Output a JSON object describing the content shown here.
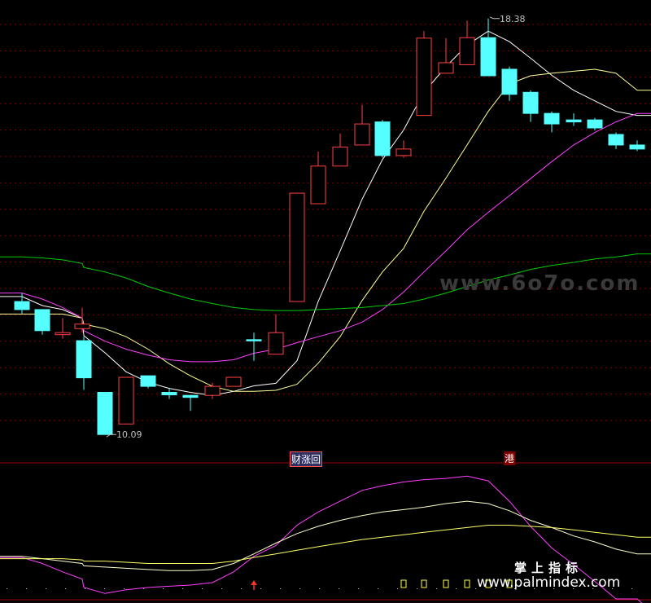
{
  "chart_data": {
    "type": "candlestick",
    "candles": [
      {
        "open": 12.74,
        "close": 12.58,
        "high": 12.91,
        "low": 12.5,
        "dir": "down"
      },
      {
        "open": 12.58,
        "close": 12.16,
        "high": 12.58,
        "low": 12.08,
        "dir": "down"
      },
      {
        "open": 12.08,
        "close": 12.12,
        "high": 12.41,
        "low": 12.0,
        "dir": "up"
      },
      {
        "open": 12.2,
        "close": 12.29,
        "high": 12.62,
        "low": 12.12,
        "dir": "up"
      },
      {
        "open": 11.96,
        "close": 11.22,
        "high": 12.04,
        "low": 10.98,
        "dir": "down"
      },
      {
        "open": 10.93,
        "close": 10.09,
        "high": 10.93,
        "low": 10.09,
        "dir": "down"
      },
      {
        "open": 10.3,
        "close": 11.23,
        "high": 11.23,
        "low": 10.3,
        "dir": "up"
      },
      {
        "open": 11.26,
        "close": 11.05,
        "high": 11.26,
        "low": 11.01,
        "dir": "down"
      },
      {
        "open": 10.93,
        "close": 10.88,
        "high": 11.01,
        "low": 10.8,
        "dir": "down"
      },
      {
        "open": 10.87,
        "close": 10.83,
        "high": 10.87,
        "low": 10.56,
        "dir": "down"
      },
      {
        "open": 10.87,
        "close": 11.05,
        "high": 11.12,
        "low": 10.8,
        "dir": "up"
      },
      {
        "open": 11.05,
        "close": 11.23,
        "high": 11.23,
        "low": 11.05,
        "dir": "up"
      },
      {
        "open": 11.98,
        "close": 11.98,
        "high": 12.12,
        "low": 11.56,
        "dir": "doji"
      },
      {
        "open": 11.69,
        "close": 12.12,
        "high": 12.49,
        "low": 11.69,
        "dir": "up"
      },
      {
        "open": 12.74,
        "close": 14.9,
        "high": 14.9,
        "low": 12.74,
        "dir": "up"
      },
      {
        "open": 14.69,
        "close": 15.44,
        "high": 15.73,
        "low": 14.69,
        "dir": "up"
      },
      {
        "open": 15.44,
        "close": 15.82,
        "high": 16.09,
        "low": 15.44,
        "dir": "up"
      },
      {
        "open": 15.86,
        "close": 16.28,
        "high": 16.66,
        "low": 15.86,
        "dir": "up"
      },
      {
        "open": 16.32,
        "close": 15.65,
        "high": 16.36,
        "low": 15.61,
        "dir": "down"
      },
      {
        "open": 15.65,
        "close": 15.78,
        "high": 15.95,
        "low": 15.61,
        "dir": "up"
      },
      {
        "open": 16.45,
        "close": 17.99,
        "high": 18.13,
        "low": 16.45,
        "dir": "up"
      },
      {
        "open": 17.29,
        "close": 17.5,
        "high": 17.99,
        "low": 17.29,
        "dir": "up"
      },
      {
        "open": 17.46,
        "close": 18.0,
        "high": 18.34,
        "low": 17.46,
        "dir": "up"
      },
      {
        "open": 18.0,
        "close": 17.24,
        "high": 18.38,
        "low": 17.24,
        "dir": "down"
      },
      {
        "open": 17.37,
        "close": 16.87,
        "high": 17.42,
        "low": 16.74,
        "dir": "down"
      },
      {
        "open": 16.91,
        "close": 16.49,
        "high": 16.95,
        "low": 16.32,
        "dir": "down"
      },
      {
        "open": 16.49,
        "close": 16.28,
        "high": 16.53,
        "low": 16.11,
        "dir": "down"
      },
      {
        "open": 16.36,
        "close": 16.32,
        "high": 16.49,
        "low": 16.24,
        "dir": "down"
      },
      {
        "open": 16.36,
        "close": 16.2,
        "high": 16.4,
        "low": 16.15,
        "dir": "down"
      },
      {
        "open": 16.07,
        "close": 15.86,
        "high": 16.11,
        "low": 15.78,
        "dir": "down"
      },
      {
        "open": 15.86,
        "close": 15.78,
        "high": 15.95,
        "low": 15.74,
        "dir": "down"
      }
    ],
    "candle_x": [
      27,
      52,
      77,
      101,
      103,
      129,
      155,
      182,
      208,
      234,
      261,
      287,
      312,
      339,
      365,
      391,
      418,
      445,
      470,
      496,
      521,
      548,
      574,
      600,
      626,
      652,
      678,
      705,
      731,
      757,
      783
    ],
    "price_range": [
      9.85,
      18.75
    ],
    "price_labels": [
      {
        "text": "18.38",
        "value": 18.38,
        "index": 23
      },
      {
        "text": "10.09",
        "value": 10.09,
        "index": 5
      }
    ],
    "ma_lines": [
      {
        "color": "#ffffff",
        "values": [
          [
            0,
            12.84
          ],
          [
            1,
            12.66
          ],
          [
            2,
            12.58
          ],
          [
            3,
            12.41
          ],
          [
            4,
            12.06
          ],
          [
            5,
            11.72
          ],
          [
            6,
            11.34
          ],
          [
            7,
            11.13
          ],
          [
            8,
            11.01
          ],
          [
            9,
            10.93
          ],
          [
            10,
            10.87
          ],
          [
            11,
            10.95
          ],
          [
            12,
            11.06
          ],
          [
            13,
            11.11
          ],
          [
            14,
            11.56
          ],
          [
            15,
            12.74
          ],
          [
            16,
            13.75
          ],
          [
            17,
            14.78
          ],
          [
            18,
            15.57
          ],
          [
            19,
            16.16
          ],
          [
            20,
            16.91
          ],
          [
            21,
            17.42
          ],
          [
            22,
            17.85
          ],
          [
            23,
            18.13
          ],
          [
            24,
            17.92
          ],
          [
            25,
            17.59
          ],
          [
            26,
            17.25
          ],
          [
            27,
            16.95
          ],
          [
            28,
            16.74
          ],
          [
            29,
            16.53
          ],
          [
            30,
            16.45
          ]
        ]
      },
      {
        "color": "#ffff99",
        "values": [
          [
            0,
            12.49
          ],
          [
            1,
            12.49
          ],
          [
            2,
            12.49
          ],
          [
            3,
            12.41
          ],
          [
            4,
            12.29
          ],
          [
            5,
            12.2
          ],
          [
            6,
            12.04
          ],
          [
            7,
            11.79
          ],
          [
            8,
            11.5
          ],
          [
            9,
            11.26
          ],
          [
            10,
            11.05
          ],
          [
            11,
            10.95
          ],
          [
            12,
            10.95
          ],
          [
            13,
            10.97
          ],
          [
            14,
            11.09
          ],
          [
            15,
            11.51
          ],
          [
            16,
            12.04
          ],
          [
            17,
            12.76
          ],
          [
            18,
            13.33
          ],
          [
            19,
            13.8
          ],
          [
            20,
            14.54
          ],
          [
            21,
            15.2
          ],
          [
            22,
            15.86
          ],
          [
            23,
            16.53
          ],
          [
            24,
            17.08
          ],
          [
            25,
            17.24
          ],
          [
            26,
            17.29
          ],
          [
            27,
            17.33
          ],
          [
            28,
            17.37
          ],
          [
            29,
            17.29
          ],
          [
            30,
            16.95
          ]
        ]
      },
      {
        "color": "#ff40ff",
        "values": [
          [
            0,
            12.91
          ],
          [
            1,
            12.79
          ],
          [
            2,
            12.62
          ],
          [
            3,
            12.41
          ],
          [
            4,
            12.16
          ],
          [
            5,
            11.95
          ],
          [
            6,
            11.79
          ],
          [
            7,
            11.67
          ],
          [
            8,
            11.58
          ],
          [
            9,
            11.54
          ],
          [
            10,
            11.54
          ],
          [
            11,
            11.58
          ],
          [
            12,
            11.71
          ],
          [
            13,
            11.79
          ],
          [
            14,
            11.92
          ],
          [
            15,
            12.04
          ],
          [
            16,
            12.16
          ],
          [
            17,
            12.33
          ],
          [
            18,
            12.58
          ],
          [
            19,
            12.93
          ],
          [
            20,
            13.33
          ],
          [
            21,
            13.75
          ],
          [
            22,
            14.17
          ],
          [
            23,
            14.52
          ],
          [
            24,
            14.85
          ],
          [
            25,
            15.19
          ],
          [
            26,
            15.53
          ],
          [
            27,
            15.86
          ],
          [
            28,
            16.11
          ],
          [
            29,
            16.32
          ],
          [
            30,
            16.49
          ]
        ]
      },
      {
        "color": "#00cc00",
        "values": [
          [
            0,
            13.63
          ],
          [
            1,
            13.61
          ],
          [
            2,
            13.57
          ],
          [
            3,
            13.5
          ],
          [
            4,
            13.42
          ],
          [
            5,
            13.33
          ],
          [
            6,
            13.21
          ],
          [
            7,
            13.04
          ],
          [
            8,
            12.91
          ],
          [
            9,
            12.79
          ],
          [
            10,
            12.7
          ],
          [
            11,
            12.62
          ],
          [
            12,
            12.58
          ],
          [
            13,
            12.56
          ],
          [
            14,
            12.56
          ],
          [
            15,
            12.58
          ],
          [
            16,
            12.6
          ],
          [
            17,
            12.62
          ],
          [
            18,
            12.66
          ],
          [
            19,
            12.7
          ],
          [
            20,
            12.79
          ],
          [
            21,
            12.91
          ],
          [
            22,
            13.04
          ],
          [
            23,
            13.17
          ],
          [
            24,
            13.27
          ],
          [
            25,
            13.38
          ],
          [
            26,
            13.46
          ],
          [
            27,
            13.52
          ],
          [
            28,
            13.59
          ],
          [
            29,
            13.63
          ],
          [
            30,
            13.69
          ]
        ]
      }
    ],
    "annotations": [
      {
        "text": "财涨回",
        "index": 14
      },
      {
        "text": "港",
        "index": 24
      }
    ],
    "indicator": {
      "range": [
        0,
        100
      ],
      "lines": [
        {
          "color": "#ff40ff",
          "values": [
            [
              0,
              55
            ],
            [
              1,
              50
            ],
            [
              2,
              43
            ],
            [
              3,
              37
            ],
            [
              4,
              30
            ],
            [
              5,
              25
            ],
            [
              6,
              28
            ],
            [
              7,
              30
            ],
            [
              8,
              31
            ],
            [
              9,
              32
            ],
            [
              10,
              34
            ],
            [
              11,
              43
            ],
            [
              12,
              56
            ],
            [
              13,
              65
            ],
            [
              14,
              82
            ],
            [
              15,
              93
            ],
            [
              16,
              102
            ],
            [
              17,
              111
            ],
            [
              18,
              115
            ],
            [
              19,
              118
            ],
            [
              20,
              120
            ],
            [
              21,
              121
            ],
            [
              22,
              123
            ],
            [
              23,
              119
            ],
            [
              24,
              102
            ],
            [
              25,
              81
            ],
            [
              26,
              63
            ],
            [
              27,
              49
            ],
            [
              28,
              35
            ],
            [
              29,
              20
            ],
            [
              30,
              10
            ]
          ]
        },
        {
          "color": "#ffffcc",
          "values": [
            [
              0,
              56
            ],
            [
              1,
              54
            ],
            [
              2,
              52
            ],
            [
              3,
              50
            ],
            [
              4,
              48
            ],
            [
              5,
              47
            ],
            [
              6,
              46
            ],
            [
              7,
              45
            ],
            [
              8,
              44
            ],
            [
              9,
              44
            ],
            [
              10,
              45
            ],
            [
              11,
              50
            ],
            [
              12,
              58
            ],
            [
              13,
              67
            ],
            [
              14,
              75
            ],
            [
              15,
              81
            ],
            [
              16,
              86
            ],
            [
              17,
              90
            ],
            [
              18,
              93
            ],
            [
              19,
              95
            ],
            [
              20,
              97
            ],
            [
              21,
              100
            ],
            [
              22,
              102
            ],
            [
              23,
              100
            ],
            [
              24,
              94
            ],
            [
              25,
              86
            ],
            [
              26,
              80
            ],
            [
              27,
              73
            ],
            [
              28,
              68
            ],
            [
              29,
              62
            ],
            [
              30,
              58
            ]
          ]
        },
        {
          "color": "#ffff66",
          "values": [
            [
              0,
              54
            ],
            [
              1,
              54
            ],
            [
              2,
              54
            ],
            [
              3,
              53
            ],
            [
              4,
              52
            ],
            [
              5,
              52
            ],
            [
              6,
              51
            ],
            [
              7,
              50
            ],
            [
              8,
              50
            ],
            [
              9,
              50
            ],
            [
              10,
              50
            ],
            [
              11,
              52
            ],
            [
              12,
              55
            ],
            [
              13,
              58
            ],
            [
              14,
              61
            ],
            [
              15,
              64
            ],
            [
              16,
              67
            ],
            [
              17,
              70
            ],
            [
              18,
              72
            ],
            [
              19,
              74
            ],
            [
              20,
              76
            ],
            [
              21,
              78
            ],
            [
              22,
              80
            ],
            [
              23,
              82
            ],
            [
              24,
              82
            ],
            [
              25,
              81
            ],
            [
              26,
              80
            ],
            [
              27,
              78
            ],
            [
              28,
              76
            ],
            [
              29,
              74
            ],
            [
              30,
              72
            ]
          ]
        }
      ],
      "buy_arrow_index": 12,
      "signal_marks_indices": [
        19,
        20,
        21,
        22,
        23,
        24
      ]
    },
    "colors": {
      "up": "#ff4040",
      "down": "#55ffff",
      "grid": "#800000",
      "separator": "#a00000"
    }
  },
  "watermarks": {
    "site_url": "www.6o7o.com",
    "caption": "掌上指标",
    "site_url_2": "www.palmindex.com"
  }
}
